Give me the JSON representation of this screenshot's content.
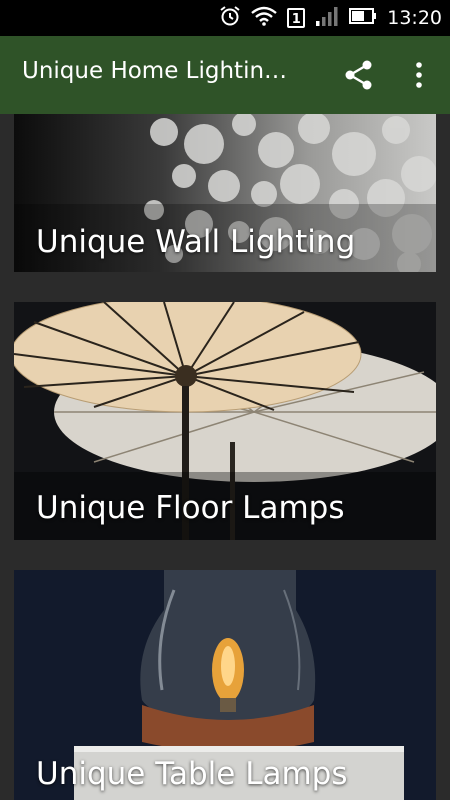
{
  "status_bar": {
    "time": "13:20",
    "sim_slot": "1",
    "icons": [
      "alarm-icon",
      "wifi-icon",
      "sim-icon",
      "signal-icon",
      "battery-icon"
    ]
  },
  "app_bar": {
    "title": "Unique Home Lightin…",
    "background_color": "#2f5328",
    "actions": [
      "share-icon",
      "more-vert-icon"
    ]
  },
  "cards": [
    {
      "label": "Unique Wall Lighting"
    },
    {
      "label": "Unique Floor Lamps"
    },
    {
      "label": "Unique Table Lamps"
    }
  ]
}
